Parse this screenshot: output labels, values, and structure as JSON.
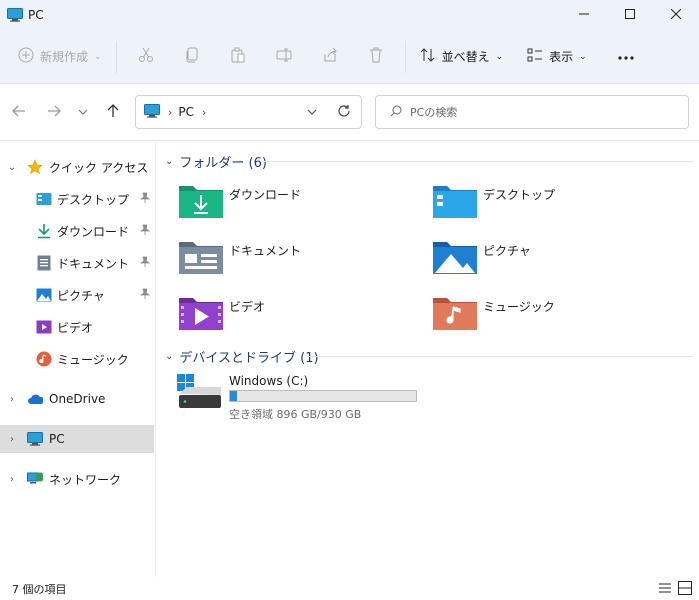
{
  "window": {
    "title": "PC",
    "controls": [
      "minimize-icon",
      "maximize-icon",
      "close-icon"
    ]
  },
  "toolbar": {
    "new_label": "新規作成",
    "sort_label": "並べ替え",
    "view_label": "表示",
    "icons": [
      "cut-icon",
      "copy-icon",
      "paste-icon",
      "rename-icon",
      "share-icon",
      "delete-icon",
      "more-icon"
    ]
  },
  "address": {
    "crumb": "PC",
    "search_placeholder": "PCの検索"
  },
  "sidebar": {
    "quick_access": "クイック アクセス",
    "items": [
      {
        "label": "デスクトップ",
        "icon": "desktop-icon",
        "pinned": true
      },
      {
        "label": "ダウンロード",
        "icon": "download-icon",
        "pinned": true
      },
      {
        "label": "ドキュメント",
        "icon": "document-icon",
        "pinned": true
      },
      {
        "label": "ピクチャ",
        "icon": "pictures-icon",
        "pinned": true
      },
      {
        "label": "ビデオ",
        "icon": "video-icon",
        "pinned": false
      },
      {
        "label": "ミュージック",
        "icon": "music-icon",
        "pinned": false
      }
    ],
    "onedrive": "OneDrive",
    "pc": "PC",
    "network": "ネットワーク"
  },
  "main": {
    "folders_header": "フォルダー (6)",
    "folders": [
      {
        "name": "ダウンロード",
        "icon": "downloads-folder-icon"
      },
      {
        "name": "デスクトップ",
        "icon": "desktop-folder-icon"
      },
      {
        "name": "ドキュメント",
        "icon": "documents-folder-icon"
      },
      {
        "name": "ピクチャ",
        "icon": "pictures-folder-icon"
      },
      {
        "name": "ビデオ",
        "icon": "videos-folder-icon"
      },
      {
        "name": "ミュージック",
        "icon": "music-folder-icon"
      }
    ],
    "drives_header": "デバイスとドライブ (1)",
    "drive": {
      "name": "Windows (C:)",
      "free_text": "空き領域 896 GB/930 GB",
      "used_fraction": 0.037
    }
  },
  "status": {
    "count": "7 個の項目"
  },
  "colors": {
    "accent": "#0067c0",
    "drive_fill": "#2a8ad4",
    "header_text": "#1f3a7a"
  }
}
